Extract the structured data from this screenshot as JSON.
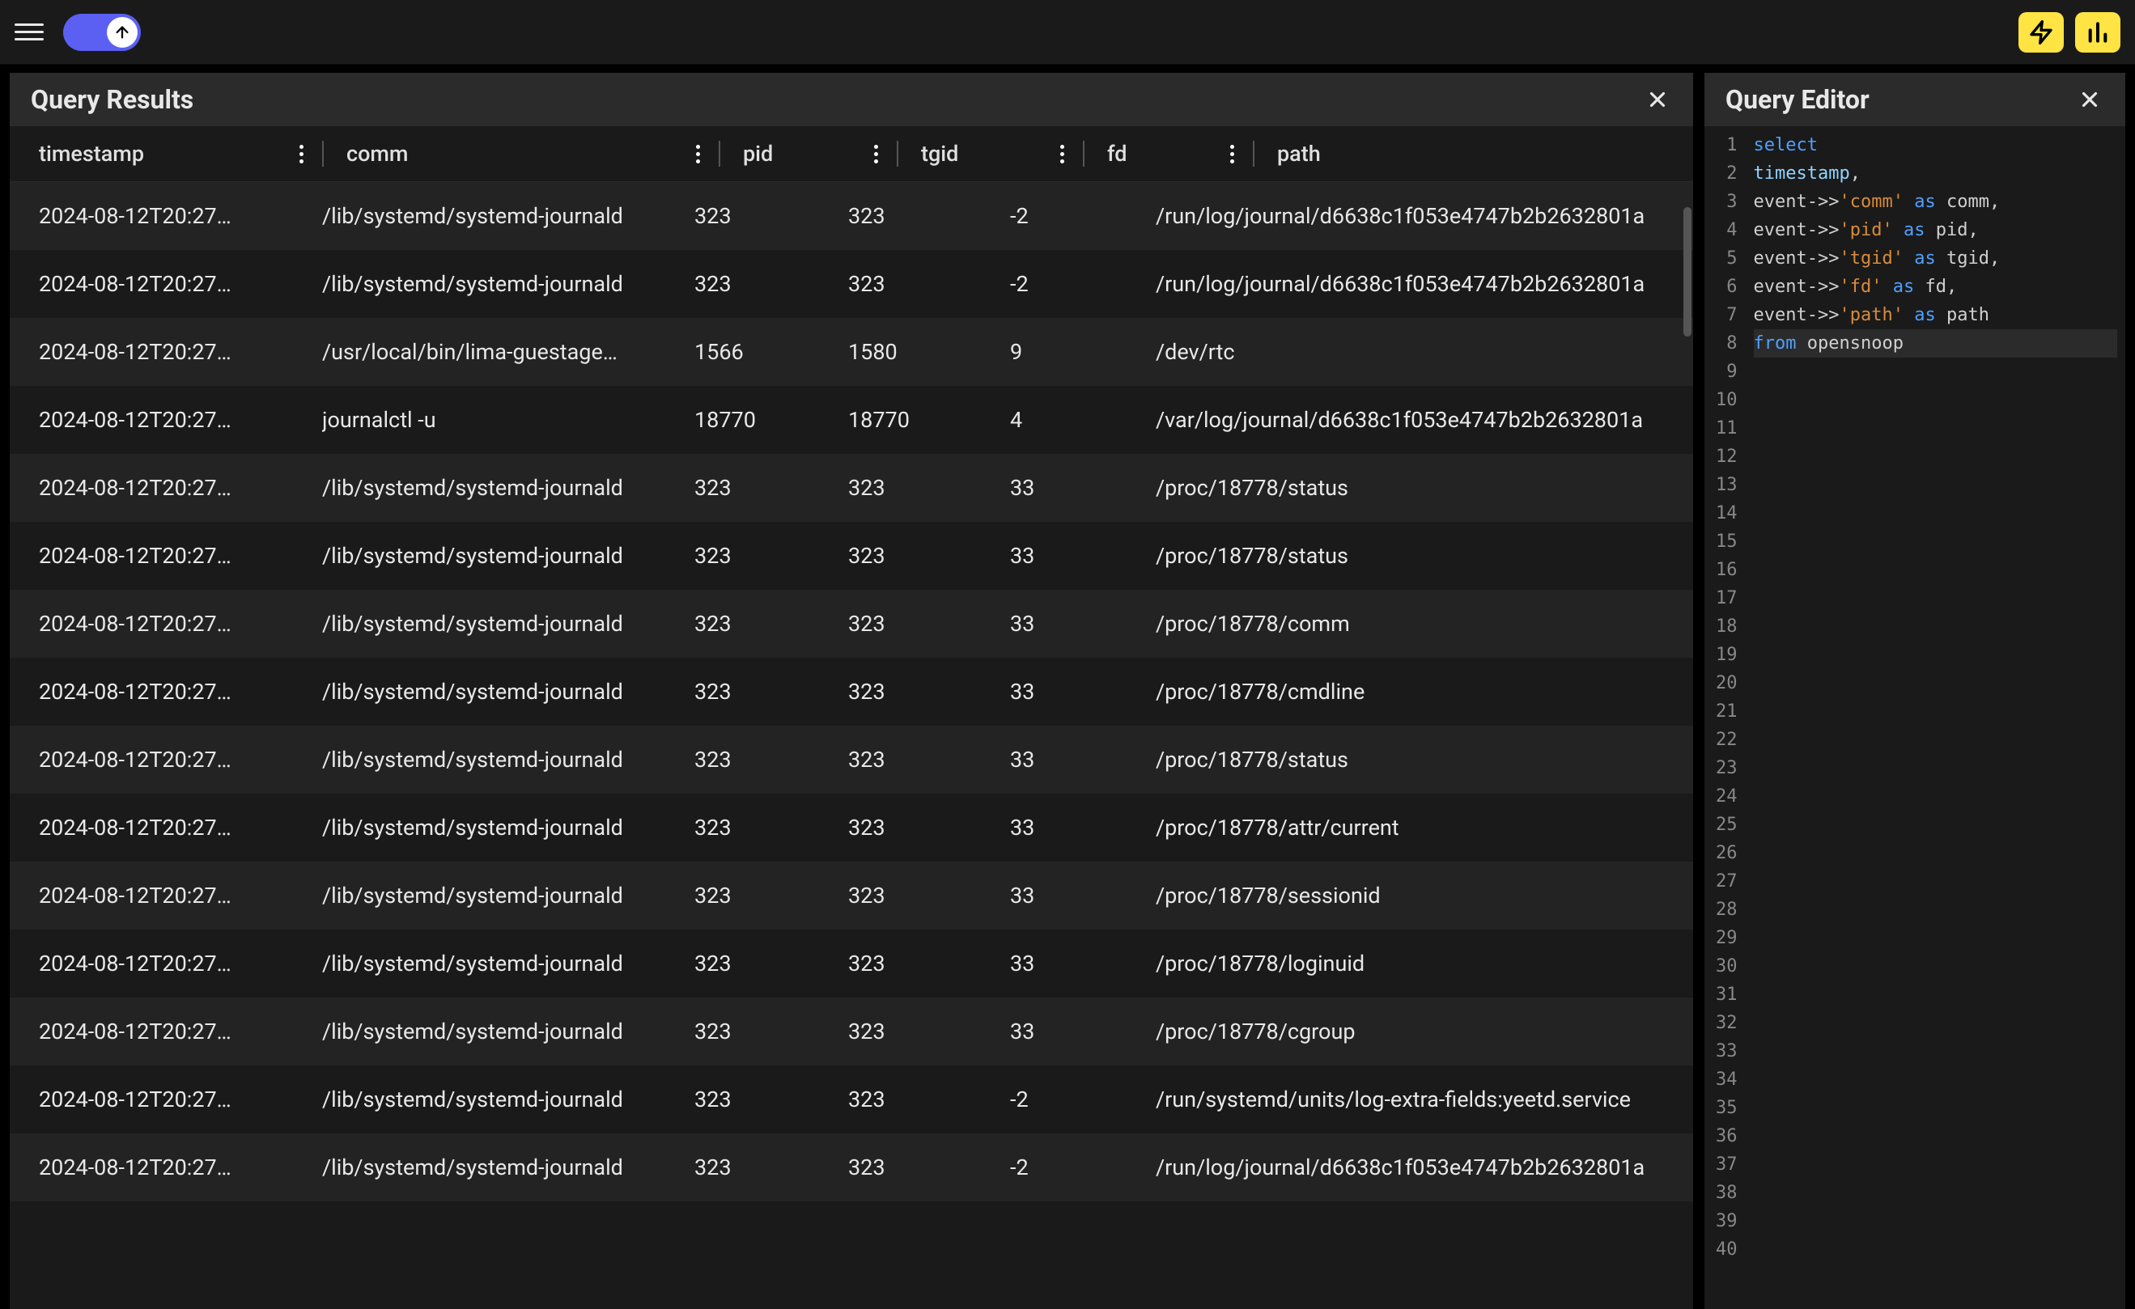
{
  "panels": {
    "results_title": "Query Results",
    "editor_title": "Query Editor"
  },
  "columns": [
    "timestamp",
    "comm",
    "pid",
    "tgid",
    "fd",
    "path"
  ],
  "rows": [
    {
      "timestamp": "2024-08-12T20:27…",
      "comm": "/lib/systemd/systemd-journald",
      "pid": "323",
      "tgid": "323",
      "fd": "-2",
      "path": "/run/log/journal/d6638c1f053e4747b2b2632801a"
    },
    {
      "timestamp": "2024-08-12T20:27…",
      "comm": "/lib/systemd/systemd-journald",
      "pid": "323",
      "tgid": "323",
      "fd": "-2",
      "path": "/run/log/journal/d6638c1f053e4747b2b2632801a"
    },
    {
      "timestamp": "2024-08-12T20:27…",
      "comm": "/usr/local/bin/lima-guestage…",
      "pid": "1566",
      "tgid": "1580",
      "fd": "9",
      "path": "/dev/rtc"
    },
    {
      "timestamp": "2024-08-12T20:27…",
      "comm": "journalctl -u",
      "pid": "18770",
      "tgid": "18770",
      "fd": "4",
      "path": "/var/log/journal/d6638c1f053e4747b2b2632801a"
    },
    {
      "timestamp": "2024-08-12T20:27…",
      "comm": "/lib/systemd/systemd-journald",
      "pid": "323",
      "tgid": "323",
      "fd": "33",
      "path": "/proc/18778/status"
    },
    {
      "timestamp": "2024-08-12T20:27…",
      "comm": "/lib/systemd/systemd-journald",
      "pid": "323",
      "tgid": "323",
      "fd": "33",
      "path": "/proc/18778/status"
    },
    {
      "timestamp": "2024-08-12T20:27…",
      "comm": "/lib/systemd/systemd-journald",
      "pid": "323",
      "tgid": "323",
      "fd": "33",
      "path": "/proc/18778/comm"
    },
    {
      "timestamp": "2024-08-12T20:27…",
      "comm": "/lib/systemd/systemd-journald",
      "pid": "323",
      "tgid": "323",
      "fd": "33",
      "path": "/proc/18778/cmdline"
    },
    {
      "timestamp": "2024-08-12T20:27…",
      "comm": "/lib/systemd/systemd-journald",
      "pid": "323",
      "tgid": "323",
      "fd": "33",
      "path": "/proc/18778/status"
    },
    {
      "timestamp": "2024-08-12T20:27…",
      "comm": "/lib/systemd/systemd-journald",
      "pid": "323",
      "tgid": "323",
      "fd": "33",
      "path": "/proc/18778/attr/current"
    },
    {
      "timestamp": "2024-08-12T20:27…",
      "comm": "/lib/systemd/systemd-journald",
      "pid": "323",
      "tgid": "323",
      "fd": "33",
      "path": "/proc/18778/sessionid"
    },
    {
      "timestamp": "2024-08-12T20:27…",
      "comm": "/lib/systemd/systemd-journald",
      "pid": "323",
      "tgid": "323",
      "fd": "33",
      "path": "/proc/18778/loginuid"
    },
    {
      "timestamp": "2024-08-12T20:27…",
      "comm": "/lib/systemd/systemd-journald",
      "pid": "323",
      "tgid": "323",
      "fd": "33",
      "path": "/proc/18778/cgroup"
    },
    {
      "timestamp": "2024-08-12T20:27…",
      "comm": "/lib/systemd/systemd-journald",
      "pid": "323",
      "tgid": "323",
      "fd": "-2",
      "path": "/run/systemd/units/log-extra-fields:yeetd.service"
    },
    {
      "timestamp": "2024-08-12T20:27…",
      "comm": "/lib/systemd/systemd-journald",
      "pid": "323",
      "tgid": "323",
      "fd": "-2",
      "path": "/run/log/journal/d6638c1f053e4747b2b2632801a"
    }
  ],
  "editor": {
    "lines": [
      {
        "n": 1,
        "tokens": [
          {
            "t": "select",
            "c": "kw"
          }
        ]
      },
      {
        "n": 2,
        "tokens": [
          {
            "t": "timestamp",
            "c": "ident"
          },
          {
            "t": ",",
            "c": "plain"
          }
        ]
      },
      {
        "n": 3,
        "tokens": [
          {
            "t": "event",
            "c": "plain"
          },
          {
            "t": "->>",
            "c": "plain"
          },
          {
            "t": "'comm'",
            "c": "str"
          },
          {
            "t": " ",
            "c": "plain"
          },
          {
            "t": "as",
            "c": "kw"
          },
          {
            "t": " comm,",
            "c": "plain"
          }
        ]
      },
      {
        "n": 4,
        "tokens": [
          {
            "t": "event",
            "c": "plain"
          },
          {
            "t": "->>",
            "c": "plain"
          },
          {
            "t": "'pid'",
            "c": "str"
          },
          {
            "t": " ",
            "c": "plain"
          },
          {
            "t": "as",
            "c": "kw"
          },
          {
            "t": " pid,",
            "c": "plain"
          }
        ]
      },
      {
        "n": 5,
        "tokens": [
          {
            "t": "event",
            "c": "plain"
          },
          {
            "t": "->>",
            "c": "plain"
          },
          {
            "t": "'tgid'",
            "c": "str"
          },
          {
            "t": " ",
            "c": "plain"
          },
          {
            "t": "as",
            "c": "kw"
          },
          {
            "t": " tgid,",
            "c": "plain"
          }
        ]
      },
      {
        "n": 6,
        "tokens": [
          {
            "t": "event",
            "c": "plain"
          },
          {
            "t": "->>",
            "c": "plain"
          },
          {
            "t": "'fd'",
            "c": "str"
          },
          {
            "t": " ",
            "c": "plain"
          },
          {
            "t": "as",
            "c": "kw"
          },
          {
            "t": " fd,",
            "c": "plain"
          }
        ]
      },
      {
        "n": 7,
        "tokens": [
          {
            "t": "event",
            "c": "plain"
          },
          {
            "t": "->>",
            "c": "plain"
          },
          {
            "t": "'path'",
            "c": "str"
          },
          {
            "t": " ",
            "c": "plain"
          },
          {
            "t": "as",
            "c": "kw"
          },
          {
            "t": " path",
            "c": "plain"
          }
        ]
      },
      {
        "n": 8,
        "tokens": [
          {
            "t": "from",
            "c": "kw"
          },
          {
            "t": " opensnoop",
            "c": "plain"
          }
        ],
        "active": true
      }
    ],
    "blank_from": 9,
    "blank_to": 40
  }
}
